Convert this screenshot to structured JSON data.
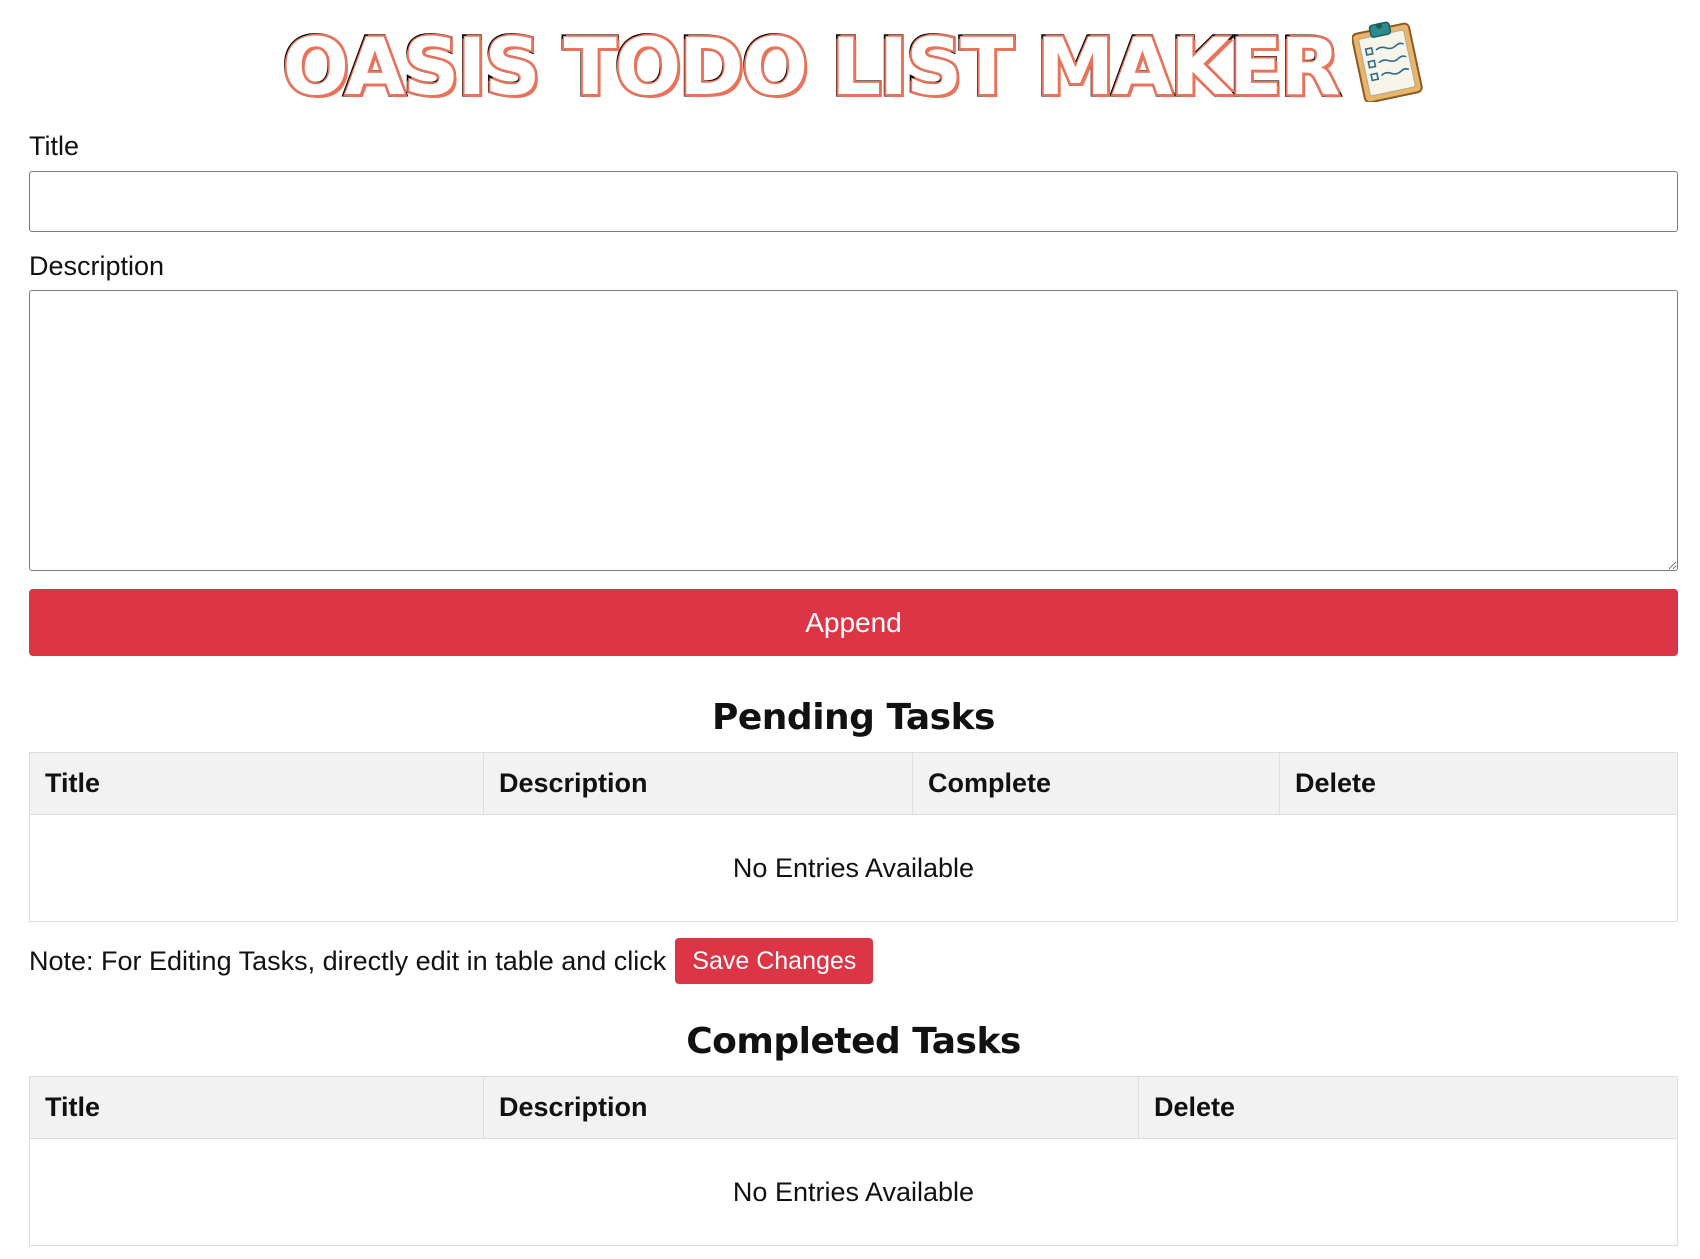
{
  "header": {
    "title": "OASIS TODO LIST MAKER",
    "icon": "clipboard-icon"
  },
  "form": {
    "title_label": "Title",
    "title_value": "",
    "description_label": "Description",
    "description_value": "",
    "append_label": "Append"
  },
  "pending": {
    "heading": "Pending Tasks",
    "columns": [
      "Title",
      "Description",
      "Complete",
      "Delete"
    ],
    "empty_text": "No Entries Available"
  },
  "note": {
    "text": "Note: For Editing Tasks, directly edit in table and click",
    "save_label": "Save Changes"
  },
  "completed": {
    "heading": "Completed Tasks",
    "columns": [
      "Title",
      "Description",
      "Delete"
    ],
    "empty_text": "No Entries Available"
  },
  "colors": {
    "accent": "#dc3545",
    "header_bg": "#f2f2f2",
    "border": "#dedede"
  }
}
